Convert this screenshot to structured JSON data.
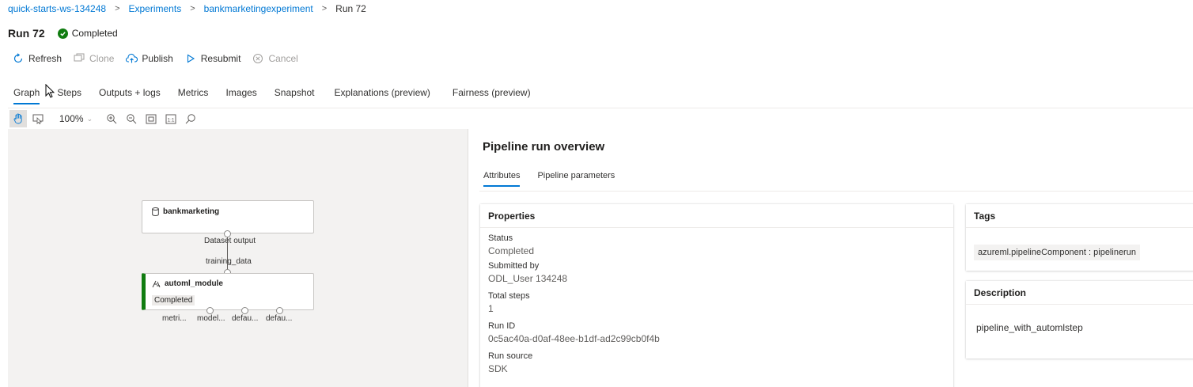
{
  "breadcrumb": {
    "workspace": "quick-starts-ws-134248",
    "experiments": "Experiments",
    "experiment": "bankmarketingexperiment",
    "current": "Run 72"
  },
  "run": {
    "title": "Run 72",
    "status": "Completed"
  },
  "commands": {
    "refresh": "Refresh",
    "clone": "Clone",
    "publish": "Publish",
    "resubmit": "Resubmit",
    "cancel": "Cancel"
  },
  "tabs": [
    "Graph",
    "Steps",
    "Outputs + logs",
    "Metrics",
    "Images",
    "Snapshot",
    "Explanations (preview)",
    "Fairness (preview)"
  ],
  "graph": {
    "zoom": "100%",
    "dataset_node": {
      "name": "bankmarketing",
      "output_label": "Dataset output"
    },
    "edge_label": "training_data",
    "automl_node": {
      "name": "automl_module",
      "status": "Completed",
      "outputs": [
        "metri...",
        "model...",
        "defau...",
        "defau..."
      ]
    }
  },
  "overview": {
    "title": "Pipeline run overview",
    "tabs": [
      "Attributes",
      "Pipeline parameters"
    ],
    "properties": {
      "header": "Properties",
      "items": [
        {
          "label": "Status",
          "value": "Completed"
        },
        {
          "label": "Submitted by",
          "value": "ODL_User 134248"
        },
        {
          "label": "Total steps",
          "value": "1"
        },
        {
          "label": "Run ID",
          "value": "0c5ac40a-d0af-48ee-b1df-ad2c99cb0f4b"
        },
        {
          "label": "Run source",
          "value": "SDK"
        }
      ]
    },
    "tags": {
      "header": "Tags",
      "chip": "azureml.pipelineComponent : pipelinerun"
    },
    "description": {
      "header": "Description",
      "text": "pipeline_with_automlstep"
    }
  },
  "colors": {
    "accent": "#0078d4",
    "success": "#107c10",
    "canvas": "#f3f2f1"
  }
}
